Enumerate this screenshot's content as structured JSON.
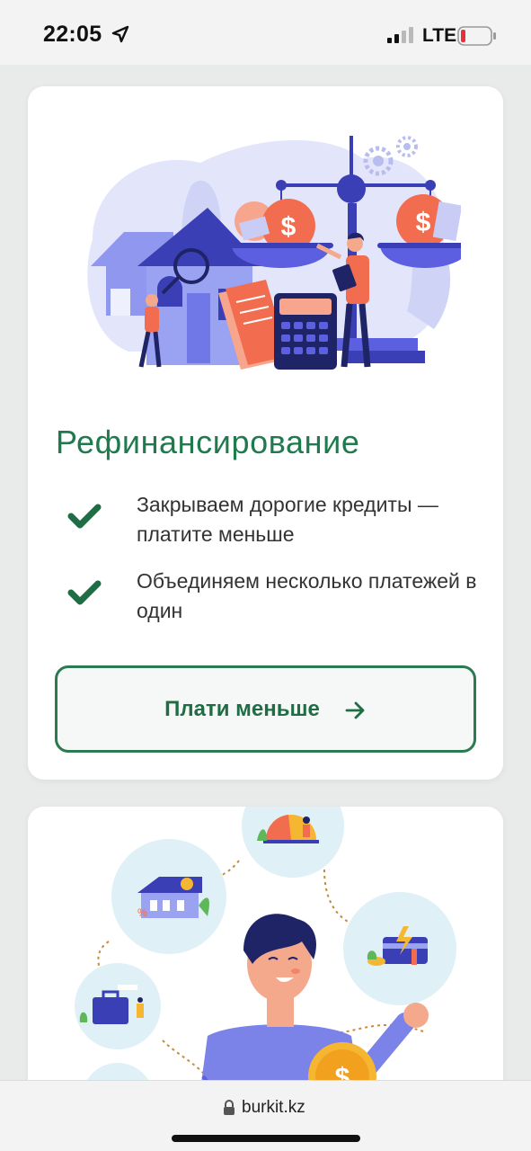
{
  "status_bar": {
    "time": "22:05",
    "network": "LTE",
    "icons": [
      "location-arrow-icon",
      "signal-icon",
      "battery-low-icon"
    ]
  },
  "cards": [
    {
      "title": "Рефинансирование",
      "illustration": "refinance-scales-illustration",
      "features": [
        {
          "icon": "check-icon",
          "text": "Закрываем дорогие кредиты — платите меньше"
        },
        {
          "icon": "check-icon",
          "text": "Объединяем несколько платежей в один"
        }
      ],
      "button_label": "Плати меньше",
      "button_icon": "arrow-right-icon"
    },
    {
      "illustration": "man-with-financial-goals-illustration"
    }
  ],
  "browser": {
    "url": "burkit.kz",
    "icon": "lock-icon"
  },
  "colors": {
    "accent_green": "#1f7a4d",
    "illustration_blue": "#5b5fe0",
    "illustration_orange": "#f26d4f"
  }
}
